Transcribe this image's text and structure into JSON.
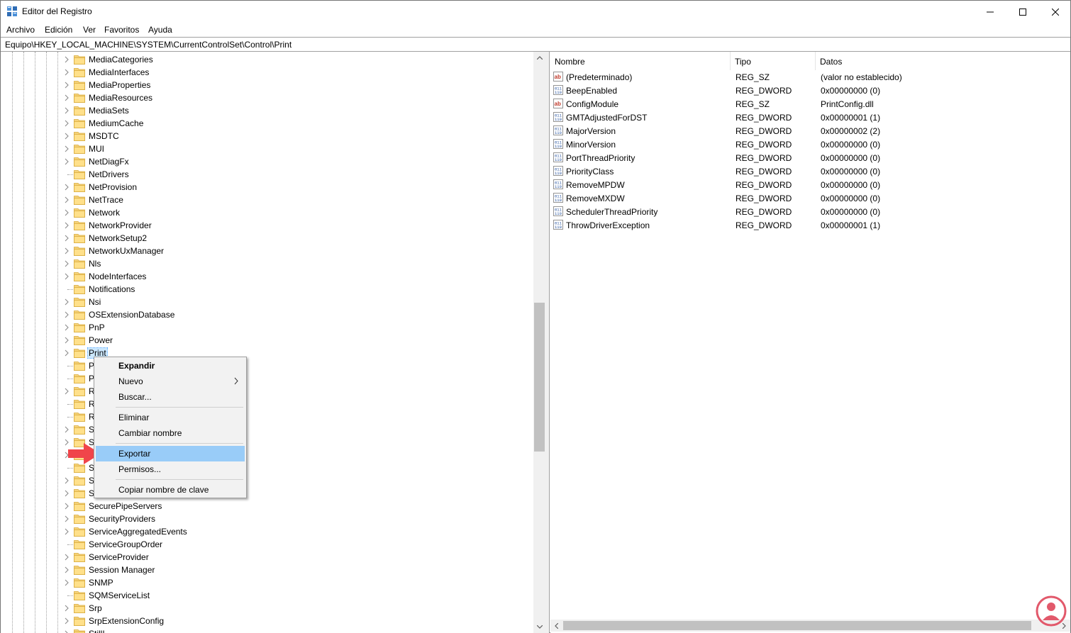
{
  "window": {
    "title": "Editor del Registro"
  },
  "menu": [
    "Archivo",
    "Edición",
    "Ver",
    "Favoritos",
    "Ayuda"
  ],
  "address": "Equipo\\HKEY_LOCAL_MACHINE\\SYSTEM\\CurrentControlSet\\Control\\Print",
  "tree": {
    "items": [
      {
        "label": "MediaCategories",
        "expandable": true
      },
      {
        "label": "MediaInterfaces",
        "expandable": true
      },
      {
        "label": "MediaProperties",
        "expandable": true
      },
      {
        "label": "MediaResources",
        "expandable": true
      },
      {
        "label": "MediaSets",
        "expandable": true
      },
      {
        "label": "MediumCache",
        "expandable": true
      },
      {
        "label": "MSDTC",
        "expandable": true
      },
      {
        "label": "MUI",
        "expandable": true
      },
      {
        "label": "NetDiagFx",
        "expandable": true
      },
      {
        "label": "NetDrivers",
        "expandable": false
      },
      {
        "label": "NetProvision",
        "expandable": true
      },
      {
        "label": "NetTrace",
        "expandable": true
      },
      {
        "label": "Network",
        "expandable": true
      },
      {
        "label": "NetworkProvider",
        "expandable": true
      },
      {
        "label": "NetworkSetup2",
        "expandable": true
      },
      {
        "label": "NetworkUxManager",
        "expandable": true
      },
      {
        "label": "Nls",
        "expandable": true
      },
      {
        "label": "NodeInterfaces",
        "expandable": true
      },
      {
        "label": "Notifications",
        "expandable": false
      },
      {
        "label": "Nsi",
        "expandable": true
      },
      {
        "label": "OSExtensionDatabase",
        "expandable": true
      },
      {
        "label": "PnP",
        "expandable": true
      },
      {
        "label": "Power",
        "expandable": true
      },
      {
        "label": "Print",
        "expandable": true,
        "selected": true
      },
      {
        "label": "P",
        "expandable": false
      },
      {
        "label": "P",
        "expandable": false
      },
      {
        "label": "R",
        "expandable": true
      },
      {
        "label": "R",
        "expandable": false
      },
      {
        "label": "R",
        "expandable": false
      },
      {
        "label": "S",
        "expandable": true
      },
      {
        "label": "S",
        "expandable": true
      },
      {
        "label": "S",
        "expandable": true
      },
      {
        "label": "S",
        "expandable": false
      },
      {
        "label": "S",
        "expandable": true
      },
      {
        "label": "S",
        "expandable": true
      },
      {
        "label": "SecurePipeServers",
        "expandable": true
      },
      {
        "label": "SecurityProviders",
        "expandable": true
      },
      {
        "label": "ServiceAggregatedEvents",
        "expandable": true
      },
      {
        "label": "ServiceGroupOrder",
        "expandable": false
      },
      {
        "label": "ServiceProvider",
        "expandable": true
      },
      {
        "label": "Session Manager",
        "expandable": true
      },
      {
        "label": "SNMP",
        "expandable": true
      },
      {
        "label": "SQMServiceList",
        "expandable": false
      },
      {
        "label": "Srp",
        "expandable": true
      },
      {
        "label": "SrpExtensionConfig",
        "expandable": true
      },
      {
        "label": "StillI",
        "expandable": true
      }
    ]
  },
  "values": {
    "headers": {
      "name": "Nombre",
      "type": "Tipo",
      "data": "Datos"
    },
    "rows": [
      {
        "icon": "string-value-icon",
        "name": "(Predeterminado)",
        "type": "REG_SZ",
        "data": "(valor no establecido)"
      },
      {
        "icon": "binary-value-icon",
        "name": "BeepEnabled",
        "type": "REG_DWORD",
        "data": "0x00000000 (0)"
      },
      {
        "icon": "string-value-icon",
        "name": "ConfigModule",
        "type": "REG_SZ",
        "data": "PrintConfig.dll"
      },
      {
        "icon": "binary-value-icon",
        "name": "GMTAdjustedForDST",
        "type": "REG_DWORD",
        "data": "0x00000001 (1)"
      },
      {
        "icon": "binary-value-icon",
        "name": "MajorVersion",
        "type": "REG_DWORD",
        "data": "0x00000002 (2)"
      },
      {
        "icon": "binary-value-icon",
        "name": "MinorVersion",
        "type": "REG_DWORD",
        "data": "0x00000000 (0)"
      },
      {
        "icon": "binary-value-icon",
        "name": "PortThreadPriority",
        "type": "REG_DWORD",
        "data": "0x00000000 (0)"
      },
      {
        "icon": "binary-value-icon",
        "name": "PriorityClass",
        "type": "REG_DWORD",
        "data": "0x00000000 (0)"
      },
      {
        "icon": "binary-value-icon",
        "name": "RemoveMPDW",
        "type": "REG_DWORD",
        "data": "0x00000000 (0)"
      },
      {
        "icon": "binary-value-icon",
        "name": "RemoveMXDW",
        "type": "REG_DWORD",
        "data": "0x00000000 (0)"
      },
      {
        "icon": "binary-value-icon",
        "name": "SchedulerThreadPriority",
        "type": "REG_DWORD",
        "data": "0x00000000 (0)"
      },
      {
        "icon": "binary-value-icon",
        "name": "ThrowDriverException",
        "type": "REG_DWORD",
        "data": "0x00000001 (1)"
      }
    ]
  },
  "context_menu": {
    "items": [
      {
        "label": "Expandir",
        "bold": true
      },
      {
        "label": "Nuevo",
        "submenu": true
      },
      {
        "label": "Buscar..."
      },
      {
        "separator": true
      },
      {
        "label": "Eliminar"
      },
      {
        "label": "Cambiar nombre"
      },
      {
        "separator": true
      },
      {
        "label": "Exportar",
        "highlighted": true
      },
      {
        "label": "Permisos..."
      },
      {
        "separator": true
      },
      {
        "label": "Copiar nombre de clave"
      }
    ]
  },
  "colors": {
    "selection": "#cce8ff",
    "menu_highlight": "#99ccf8",
    "folder": "#ffe08a",
    "annotation_arrow": "#f0454a",
    "logo": "#e2596b"
  }
}
